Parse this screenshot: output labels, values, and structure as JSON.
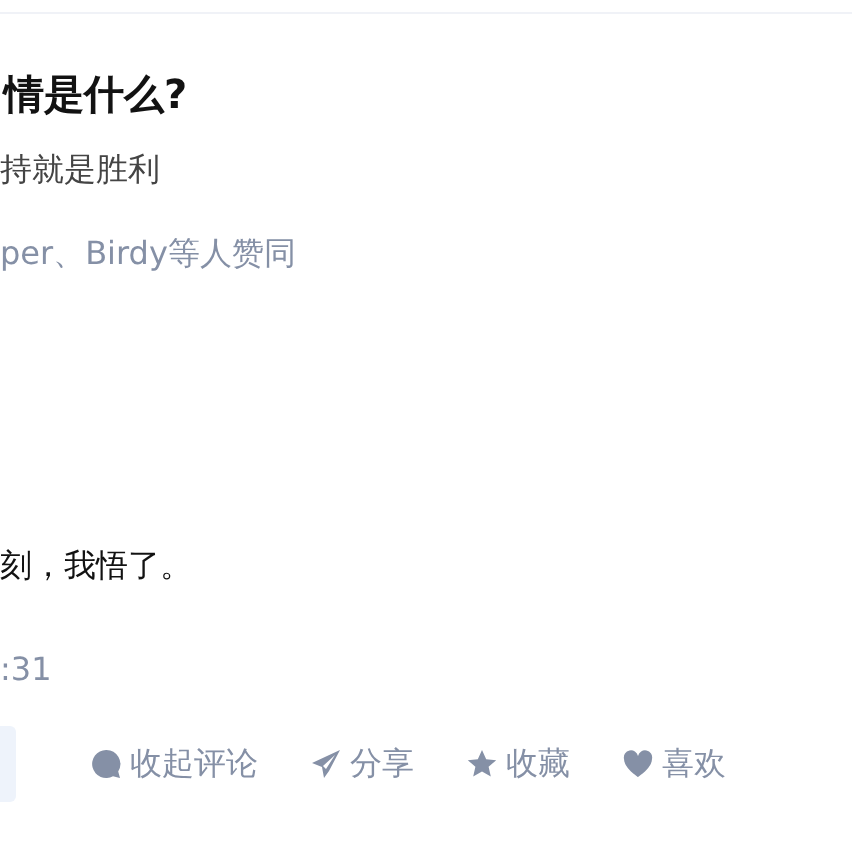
{
  "question": {
    "title": "情是什么?"
  },
  "answer": {
    "excerpt": "持就是胜利",
    "upvoters": "per、Birdy等人赞同",
    "body": "刻，我悟了。",
    "time": ":31"
  },
  "actions": [
    {
      "kind": "comment",
      "label": "收起评论"
    },
    {
      "kind": "share",
      "label": "分享"
    },
    {
      "kind": "favorite",
      "label": "收藏"
    },
    {
      "kind": "like",
      "label": "喜欢"
    }
  ]
}
